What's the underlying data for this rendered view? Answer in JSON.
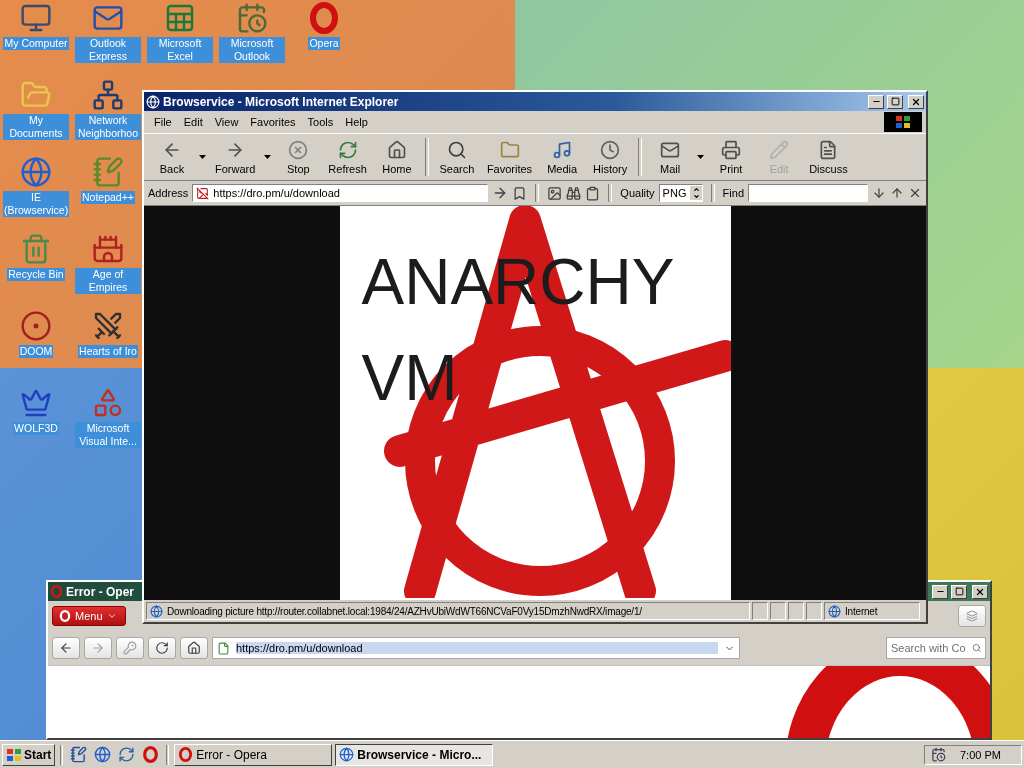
{
  "desktop": {
    "columns": [
      {
        "icons": [
          {
            "label": "My Computer"
          },
          {
            "label": "My Documents"
          },
          {
            "label": "IE (Browservice)"
          },
          {
            "label": "Recycle Bin"
          },
          {
            "label": "DOOM"
          },
          {
            "label": "WOLF3D"
          }
        ]
      },
      {
        "icons": [
          {
            "label": "Outlook Express"
          },
          {
            "label": "Network Neighborhoo"
          },
          {
            "label": "Notepad++"
          },
          {
            "label": "Age of Empires"
          },
          {
            "label": "Hearts of Iro"
          },
          {
            "label": "Microsoft Visual Inte..."
          }
        ]
      },
      {
        "icons": [
          {
            "label": "Microsoft Excel"
          }
        ]
      },
      {
        "icons": [
          {
            "label": "Microsoft Outlook"
          }
        ]
      },
      {
        "icons": [
          {
            "label": "Opera"
          }
        ]
      }
    ]
  },
  "browser_window": {
    "title": "Browservice - Microsoft Internet Explorer",
    "menu": [
      "File",
      "Edit",
      "View",
      "Favorites",
      "Tools",
      "Help"
    ],
    "toolbar": [
      {
        "buttons": [
          {
            "label": "Back",
            "disabled": false,
            "dropdown": true
          },
          {
            "label": "Forward",
            "disabled": false,
            "dropdown": true
          },
          {
            "label": "Stop",
            "disabled": false,
            "dropdown": false
          },
          {
            "label": "Refresh",
            "disabled": false,
            "dropdown": false
          },
          {
            "label": "Home",
            "disabled": false,
            "dropdown": false
          }
        ]
      },
      {
        "buttons": [
          {
            "label": "Search",
            "disabled": false,
            "dropdown": false
          },
          {
            "label": "Favorites",
            "disabled": false,
            "dropdown": false
          },
          {
            "label": "Media",
            "disabled": false,
            "dropdown": false
          },
          {
            "label": "History",
            "disabled": false,
            "dropdown": false
          }
        ]
      },
      {
        "buttons": [
          {
            "label": "Mail",
            "disabled": false,
            "dropdown": true
          },
          {
            "label": "Print",
            "disabled": false,
            "dropdown": false
          },
          {
            "label": "Edit",
            "disabled": true,
            "dropdown": false
          },
          {
            "label": "Discuss",
            "disabled": false,
            "dropdown": false
          }
        ]
      }
    ],
    "address_label": "Address",
    "url": "https://dro.pm/u/download",
    "quality_label": "Quality",
    "quality_value": "PNG",
    "find_label": "Find",
    "image_text": [
      "ANARCHY",
      "VM"
    ],
    "status_text": "Downloading picture http://router.collabnet.local:1984/24/AZHvUbiWdWT66NCVaF0Vy15DmzhNwdRX/image/1/",
    "zone": "Internet"
  },
  "opera_window": {
    "title": "Error - Oper",
    "menu_button": "Menu",
    "url": "https://dro.pm/u/download",
    "search_placeholder": "Search with Co"
  },
  "taskbar": {
    "start": "Start",
    "tasks": [
      {
        "label": "Error - Opera",
        "selected": false
      },
      {
        "label": "Browservice - Micro...",
        "selected": true
      }
    ],
    "clock": "7:00 PM"
  }
}
